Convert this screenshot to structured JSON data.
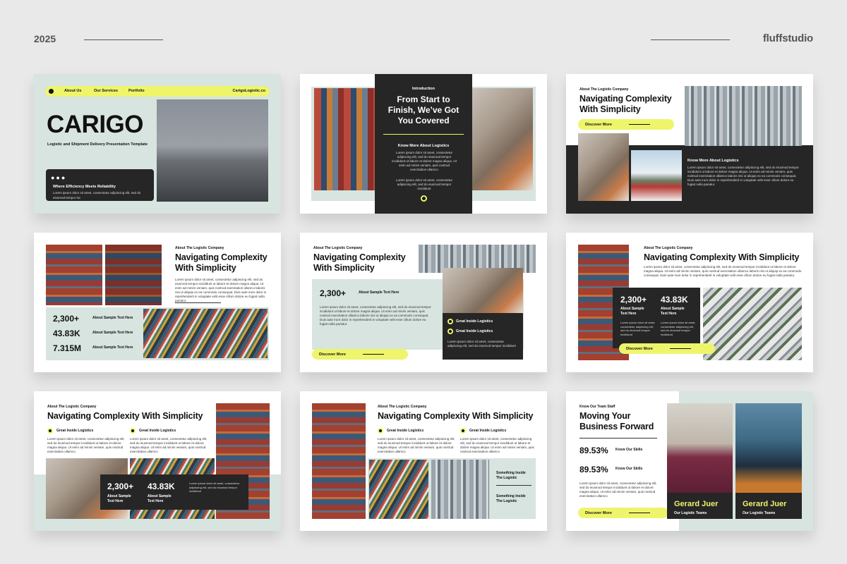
{
  "header": {
    "year": "2025",
    "brand": "fluffstudio"
  },
  "lorem": {
    "short": "Lorem ipsum dolor sit amet, consectetur adipiscing elit, sed do eiusmod tempor incididunt ut labore et dolore magna aliqua. Ut enim ad minim veniam, quis nostrud exercitation ullamco",
    "long": "Lorem ipsum dolor sit amet, consectetur adipiscing elit, sed do eiusmod tempor incididunt ut labore et dolore magna aliqua. Ut enim ad minim veniam, quis nostrud exercitation ullamco laboris nisi ut aliquip ex ea commodo consequat. Duis aute irure dolor in reprehenderit in voluptate velit esse cillum dolore eu fugiat nulla pariatur.",
    "tiny": "Lorem ipsum dolor sit amet, consectetur adipiscing elit, sed do eiusmod tempor incididunt"
  },
  "common": {
    "about": "About The Logistic Company",
    "title_two_line_1": "Navigating Complexity",
    "title_two_line_2": "With Simplicity",
    "title_one_line": "Navigating Complexity With Simplicity",
    "discover": "Discover More",
    "great": "Great Inside Logistics",
    "sample": "About Sample Text Here",
    "sample_1": "About Sample",
    "sample_2": "Text Here",
    "know_more": "Know More About Logistics"
  },
  "slide1": {
    "nav": [
      "About Us",
      "Our Services",
      "Portfolio"
    ],
    "site": "CarigoLogistic.co",
    "title": "CARIGO",
    "subtitle": "Logistic and Shipment Delivery Presentation Template",
    "box_title": "Where Efficiency Meets Reliability",
    "box_text": "Lorem ipsum dolor sit amet, consectetur adipiscing elit, sed do eiusmod tempor inc"
  },
  "slide2": {
    "kicker": "Introduction",
    "title_1": "From Start to",
    "title_2": "Finish, We’ve Got",
    "title_3": "You Covered"
  },
  "slide4": {
    "stats": [
      "2,300+",
      "43.83K",
      "7.315M"
    ]
  },
  "slide5": {
    "stat": "2,300+"
  },
  "stats_pair": [
    "2,300+",
    "43.83K"
  ],
  "slide8": {
    "caption_1": "Something Inside",
    "caption_2": "The Logistic"
  },
  "slide9": {
    "kicker": "Know Our Team Staff",
    "title_1": "Moving Your",
    "title_2": "Business Forward",
    "skills": [
      {
        "value": "89.53%",
        "label": "Know Our Skills"
      },
      {
        "value": "89.53%",
        "label": "Know Our Skills"
      }
    ],
    "people": [
      {
        "name": "Gerard Juer",
        "role": "Our Logistic Teams"
      },
      {
        "name": "Gerard Juer",
        "role": "Our Logistic Teams"
      }
    ]
  }
}
